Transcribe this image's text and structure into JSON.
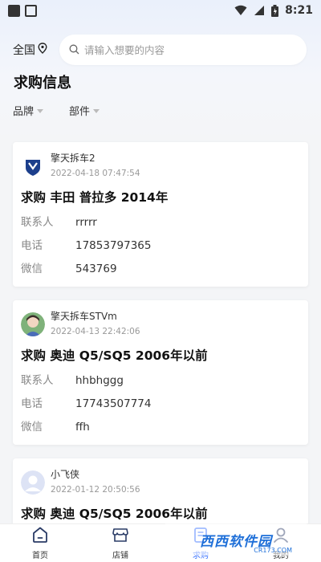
{
  "status_bar": {
    "time": "8:21"
  },
  "search": {
    "region": "全国",
    "placeholder": "请输入想要的内容"
  },
  "page_title": "求购信息",
  "filters": [
    {
      "label": "品牌"
    },
    {
      "label": "部件"
    }
  ],
  "listings": [
    {
      "shop": "擎天拆车2",
      "time": "2022-04-18 07:47:54",
      "title": "求购 丰田 普拉多 2014年",
      "contact_label": "联系人",
      "contact": "rrrrr",
      "phone_label": "电话",
      "phone": "17853797365",
      "wechat_label": "微信",
      "wechat": "543769"
    },
    {
      "shop": "擎天拆车STVm",
      "time": "2022-04-13 22:42:06",
      "title": "求购 奥迪 Q5/SQ5 2006年以前",
      "contact_label": "联系人",
      "contact": "hhbhggg",
      "phone_label": "电话",
      "phone": "17743507774",
      "wechat_label": "微信",
      "wechat": "ffh"
    },
    {
      "shop": "小飞侠",
      "time": "2022-01-12 20:50:56",
      "title": "求购 奥迪 Q5/SQ5 2006年以前"
    }
  ],
  "nav": [
    {
      "label": "首页",
      "icon": "home-icon"
    },
    {
      "label": "店铺",
      "icon": "store-icon"
    },
    {
      "label": "求购",
      "icon": "request-icon"
    },
    {
      "label": "我的",
      "icon": "user-icon"
    }
  ],
  "watermark": {
    "text": "西西软件园",
    "sub": "CR173.COM"
  },
  "colors": {
    "accent": "#2f6bff",
    "background": "#f4f5f7"
  }
}
